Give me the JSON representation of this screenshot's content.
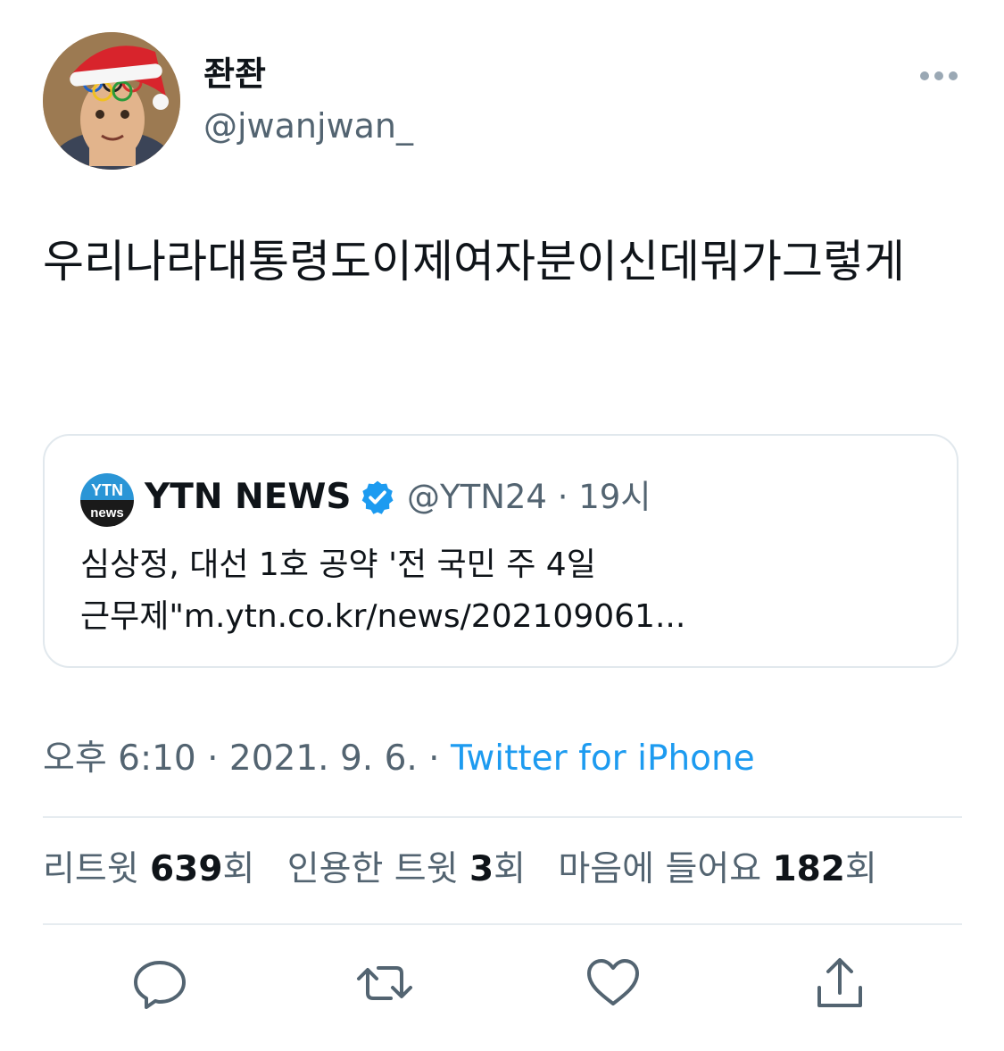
{
  "author": {
    "display_name": "좐좐",
    "handle": "@jwanjwan_",
    "avatar_icon": "avatar-photo-santa-hat"
  },
  "more_icon": "more-horizontal-icon",
  "tweet": {
    "text": "우리나라대통령도이제여자분이신데뭐가그렇게"
  },
  "quote": {
    "logo_text_top": "YTN",
    "logo_text_bottom": "news",
    "name": "YTN NEWS",
    "verified_icon": "verified-badge-icon",
    "handle_time": "@YTN24 · 19시",
    "text": "심상정, 대선 1호 공약 '전 국민 주 4일 근무제\"m.ytn.co.kr/news/202109061..."
  },
  "meta": {
    "time_date": "오후 6:10 · 2021. 9. 6. · ",
    "source": "Twitter for iPhone"
  },
  "stats": {
    "retweets_label": "리트윗 ",
    "retweets_count": "639",
    "retweets_unit": "회",
    "quotes_label": "인용한 트윗 ",
    "quotes_count": "3",
    "quotes_unit": "회",
    "likes_label": "마음에 들어요 ",
    "likes_count": "182",
    "likes_unit": "회"
  },
  "actions": [
    "reply-icon",
    "retweet-icon",
    "like-icon",
    "share-icon"
  ],
  "colors": {
    "link_blue": "#1d9bf0",
    "secondary_text": "#536471",
    "primary_text": "#0f1419",
    "border": "#e1e8ed"
  }
}
